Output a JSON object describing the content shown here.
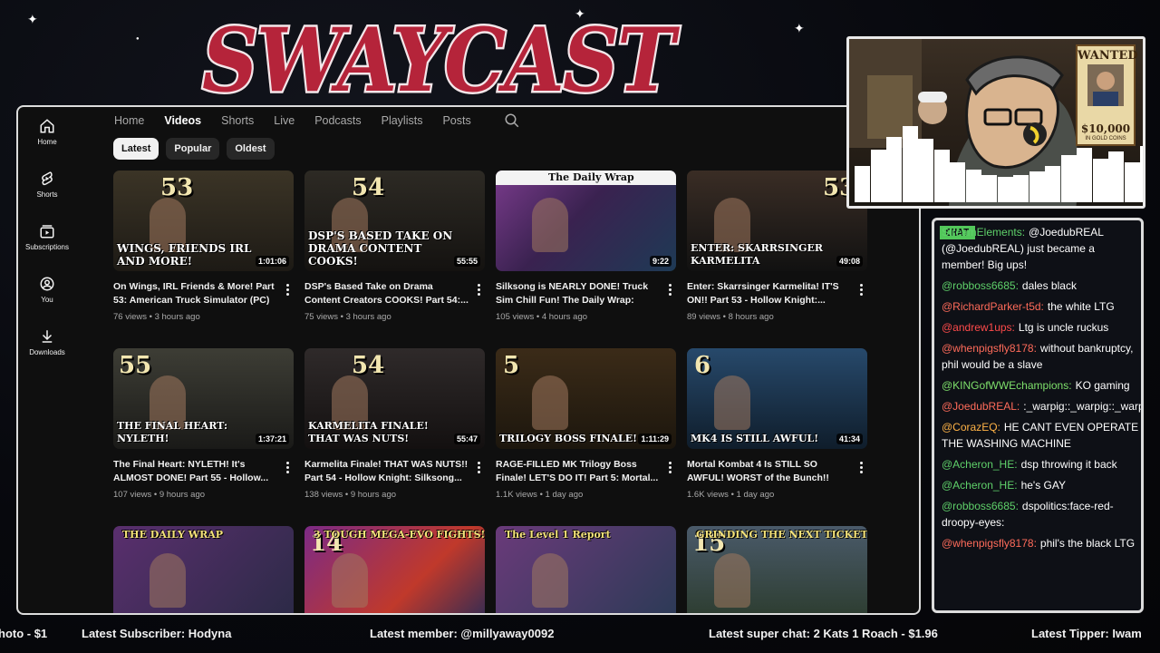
{
  "overlay": {
    "logo_text": "SWAYCAST",
    "colors": {
      "logo_fill": "#b5243a",
      "logo_stroke": "#f3e6e9",
      "chat_label_bg": "#52c75a"
    }
  },
  "sidebar": {
    "items": [
      {
        "label": "Home",
        "icon": "home-icon"
      },
      {
        "label": "Shorts",
        "icon": "shorts-icon"
      },
      {
        "label": "Subscriptions",
        "icon": "subscriptions-icon"
      },
      {
        "label": "You",
        "icon": "user-icon"
      },
      {
        "label": "Downloads",
        "icon": "download-icon"
      }
    ]
  },
  "channel_tabs": [
    "Home",
    "Videos",
    "Shorts",
    "Live",
    "Podcasts",
    "Playlists",
    "Posts"
  ],
  "active_tab": "Videos",
  "filter_chips": [
    "Latest",
    "Popular",
    "Oldest"
  ],
  "active_chip": "Latest",
  "videos": [
    {
      "thumb_num": "53",
      "thumb_text": "WINGS, FRIENDS IRL AND MORE!",
      "duration": "1:01:06",
      "title": "On Wings, IRL Friends & More! Part 53: American Truck Simulator (PC)",
      "meta": "76 views • 3 hours ago"
    },
    {
      "thumb_num": "54",
      "thumb_text": "DSP'S BASED TAKE ON DRAMA CONTENT COOKS!",
      "duration": "55:55",
      "title": "DSP's Based Take on Drama Content Creators COOKS! Part 54:...",
      "meta": "75 views • 3 hours ago"
    },
    {
      "thumb_num": "",
      "thumb_text": "The Daily Wrap",
      "duration": "9:22",
      "title": "Silksong is NEARLY DONE! Truck Sim Chill Fun! The Daily Wrap: Nov....",
      "meta": "105 views • 4 hours ago"
    },
    {
      "thumb_num": "53",
      "thumb_text": "ENTER: SKARRSINGER KARMELITA",
      "duration": "49:08",
      "title": "Enter: Skarrsinger Karmelita! IT'S ON!! Part 53 - Hollow Knight:...",
      "meta": "89 views • 8 hours ago"
    },
    {
      "thumb_num": "55",
      "thumb_text": "THE FINAL HEART: NYLETH!",
      "duration": "1:37:21",
      "title": "The Final Heart: NYLETH! It's ALMOST DONE! Part 55 - Hollow...",
      "meta": "107 views • 9 hours ago"
    },
    {
      "thumb_num": "54",
      "thumb_text": "KARMELITA FINALE! THAT WAS NUTS!",
      "duration": "55:47",
      "title": "Karmelita Finale! THAT WAS NUTS!! Part 54 - Hollow Knight: Silksong...",
      "meta": "138 views • 9 hours ago"
    },
    {
      "thumb_num": "5",
      "thumb_text": "TRILOGY BOSS FINALE!",
      "duration": "1:11:29",
      "title": "RAGE-FILLED MK Trilogy Boss Finale! LET'S DO IT! Part 5: Mortal...",
      "meta": "1.1K views • 1 day ago"
    },
    {
      "thumb_num": "6",
      "thumb_text": "MK4 IS STILL AWFUL!",
      "duration": "41:34",
      "title": "Mortal Kombat 4 Is STILL SO AWFUL! WORST of the Bunch!! Par...",
      "meta": "1.6K views • 1 day ago"
    },
    {
      "thumb_num": "",
      "thumb_text": "THE DAILY WRAP",
      "duration": "",
      "title": "",
      "meta": ""
    },
    {
      "thumb_num": "14",
      "thumb_text": "3 TOUGH MEGA-EVO FIGHTS!",
      "duration": "",
      "title": "",
      "meta": ""
    },
    {
      "thumb_num": "",
      "thumb_text": "The Level 1 Report",
      "duration": "",
      "title": "",
      "meta": ""
    },
    {
      "thumb_num": "15",
      "thumb_text": "GRINDING THE NEXT TICKET!",
      "duration": "",
      "title": "",
      "meta": ""
    }
  ],
  "webcam": {
    "poster_title": "WANTED",
    "poster_reward": "$10,000",
    "poster_sub": "IN GOLD COINS"
  },
  "chat": {
    "label": "CHAT",
    "messages": [
      {
        "user": "StreamElements:",
        "text": "@JoedubREAL (@JoedubREAL) just became a member! Big ups!",
        "color": "#5fd16a"
      },
      {
        "user": "@robboss6685:",
        "text": "dales black",
        "color": "#5fd16a"
      },
      {
        "user": "@RichardParker-t5d:",
        "text": "the white LTG",
        "color": "#ff6b5a"
      },
      {
        "user": "@andrew1ups:",
        "text": "Ltg is uncle ruckus",
        "color": "#ff4b4b"
      },
      {
        "user": "@whenpigsfly8178:",
        "text": "without bankruptcy, phil would be a slave",
        "color": "#ff6b5a"
      },
      {
        "user": "@KINGofWWEchampions:",
        "text": "KO gaming",
        "color": "#7ee06b"
      },
      {
        "user": "@JoedubREAL:",
        "text": ":_warpig::_warpig::_warpig:",
        "color": "#ff6b5a"
      },
      {
        "user": "@CorazEQ:",
        "text": "HE CANT EVEN OPERATE THE WASHING MACHINE",
        "color": "#ffb347"
      },
      {
        "user": "@Acheron_HE:",
        "text": "dsp throwing it back",
        "color": "#5fd16a"
      },
      {
        "user": "@Acheron_HE:",
        "text": "he's GAY",
        "color": "#5fd16a"
      },
      {
        "user": "@robboss6685:",
        "text": "dspolitics:face-red-droopy-eyes:",
        "color": "#5fd16a"
      },
      {
        "user": "@whenpigsfly8178:",
        "text": "phil's the black LTG",
        "color": "#ff6b5a"
      }
    ]
  },
  "ticker": [
    "hoto - $1",
    "Latest Subscriber: Hodyna",
    "Latest member: @millyaway0092",
    "Latest super chat: 2 Kats 1 Roach - $1.96",
    "Latest Tipper: Iwam"
  ]
}
